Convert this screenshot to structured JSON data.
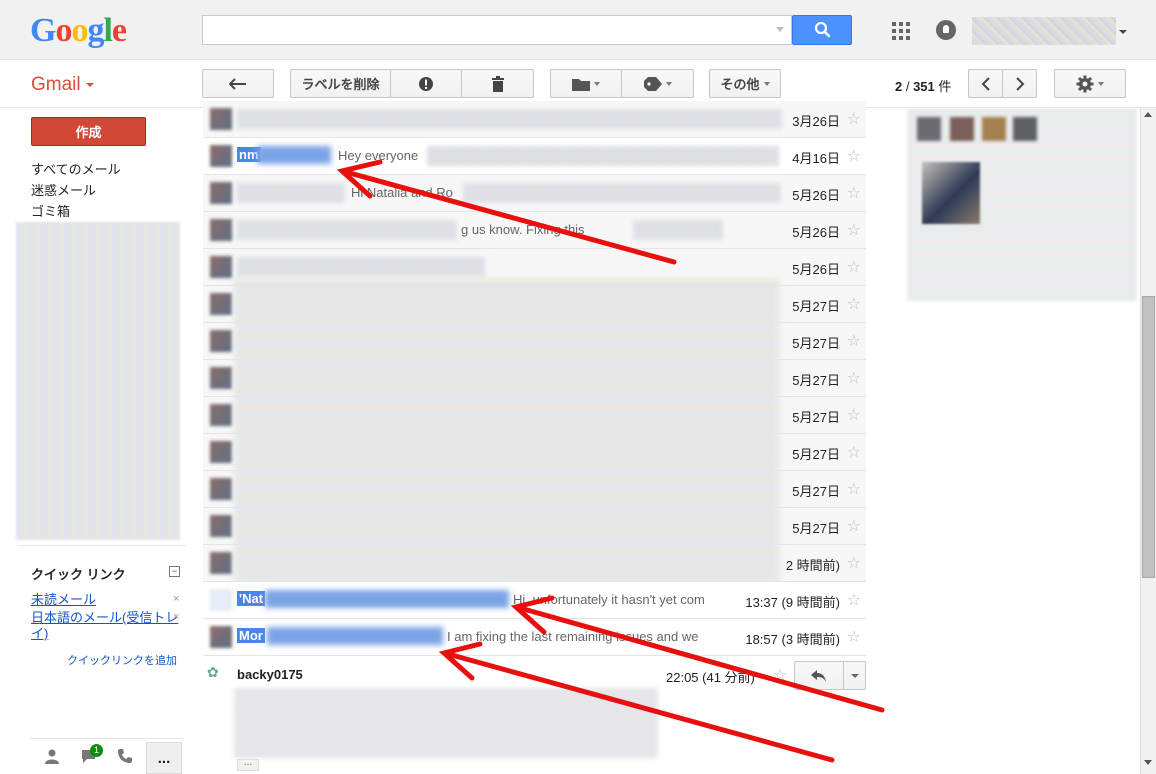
{
  "header": {
    "logo_letters": [
      "G",
      "o",
      "o",
      "g",
      "l",
      "e"
    ],
    "logo_colors": [
      "#4285f4",
      "#ea4335",
      "#fbbc05",
      "#4285f4",
      "#34a853",
      "#ea4335"
    ],
    "search_placeholder": ""
  },
  "app": {
    "name": "Gmail",
    "accent": "#dd4b39"
  },
  "toolbar": {
    "back_icon": "back-arrow-icon",
    "remove_label": "ラベルを削除",
    "spam_icon": "report-spam-icon",
    "delete_icon": "trash-icon",
    "move_icon": "folder-icon",
    "labels_icon": "tag-icon",
    "more_label": "その他",
    "pager_current": "2",
    "pager_sep": " / ",
    "pager_total": "351",
    "pager_unit": " 件",
    "settings_icon": "gear-icon"
  },
  "sidebar": {
    "compose_label": "作成",
    "items": [
      "すべてのメール",
      "迷惑メール",
      "ゴミ箱"
    ],
    "quick_links_title": "クイック リンク",
    "quick_links_toggle": "−",
    "quick_links": [
      "未読メール",
      "日本語のメール(受信トレイ)"
    ],
    "add_quick_link": "クイックリンクを追加",
    "chat_badge": "1",
    "more_label": "..."
  },
  "thread": {
    "rows": [
      {
        "sender": "",
        "snippet": "",
        "date": "3月26日"
      },
      {
        "sender": "nm",
        "snippet": "Hey everyone",
        "date": "4月16日"
      },
      {
        "sender": "",
        "snippet": "Hi Natalia and Ro",
        "date": "5月26日"
      },
      {
        "sender": "",
        "snippet": "g us know. Fixing this",
        "date": "5月26日"
      },
      {
        "sender": "",
        "snippet": "",
        "date": "5月26日"
      },
      {
        "sender": "",
        "snippet": "",
        "date": "5月27日"
      },
      {
        "sender": "",
        "snippet": "",
        "date": "5月27日"
      },
      {
        "sender": "",
        "snippet": "",
        "date": "5月27日"
      },
      {
        "sender": "",
        "snippet": "",
        "date": "5月27日"
      },
      {
        "sender": "",
        "snippet": "",
        "date": "5月27日"
      },
      {
        "sender": "",
        "snippet": "",
        "date": "5月27日"
      },
      {
        "sender": "",
        "snippet": "",
        "date": "5月27日"
      },
      {
        "sender": "",
        "snippet": "",
        "date": "2 時間前)"
      },
      {
        "sender": "'Nat",
        "snippet": "Hi, unfortunately it hasn't yet com",
        "date": "13:37 (9 時間前)"
      },
      {
        "sender": "Mor",
        "snippet": "I am fixing the last remaining issues and we",
        "date": "18:57 (3 時間前)"
      }
    ],
    "open_message": {
      "sender": "backy0175",
      "date": "22:05 (41 分前)",
      "trimmed": "..."
    }
  },
  "colors": {
    "compose_bg": "#d14836",
    "search_btn": "#4d90fe",
    "highlight": "#4a86e8",
    "arrow": "#e8100f"
  }
}
